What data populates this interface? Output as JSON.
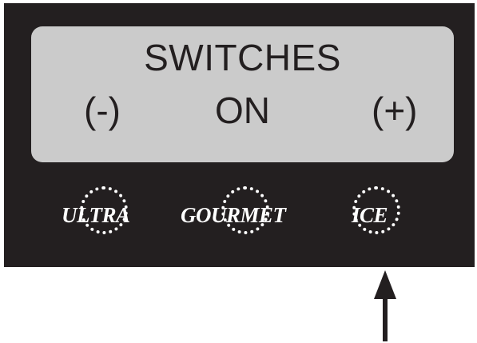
{
  "display": {
    "title": "SWITCHES",
    "minus_label": "(-)",
    "status": "ON",
    "plus_label": "(+)"
  },
  "buttons": [
    {
      "label": "ULTRA",
      "icon": "dotted-circle-icon"
    },
    {
      "label": "GOURMET",
      "icon": "dotted-circle-icon"
    },
    {
      "label": "ICE",
      "icon": "dotted-circle-icon"
    }
  ],
  "annotation": {
    "icon": "up-arrow-icon",
    "points_to": "ICE"
  },
  "colors": {
    "panel": "#231f20",
    "lcd": "#cbcbcb",
    "text_light": "#ffffff",
    "text_dark": "#231f20"
  }
}
